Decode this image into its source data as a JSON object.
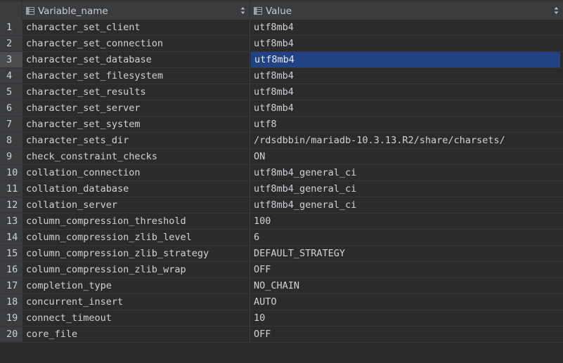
{
  "columns": {
    "variable_name": "Variable_name",
    "value": "Value"
  },
  "icons": {
    "column_icon": "table-column-icon",
    "sort_icon": "sort-arrows-icon"
  },
  "colors": {
    "background": "#2b2b2b",
    "header": "#3a3c3e",
    "selection": "#214283",
    "text": "#cfd3d8"
  },
  "selected_row": 3,
  "rows": [
    {
      "num": "1",
      "name": "character_set_client",
      "value": "utf8mb4"
    },
    {
      "num": "2",
      "name": "character_set_connection",
      "value": "utf8mb4"
    },
    {
      "num": "3",
      "name": "character_set_database",
      "value": "utf8mb4"
    },
    {
      "num": "4",
      "name": "character_set_filesystem",
      "value": "utf8mb4"
    },
    {
      "num": "5",
      "name": "character_set_results",
      "value": "utf8mb4"
    },
    {
      "num": "6",
      "name": "character_set_server",
      "value": "utf8mb4"
    },
    {
      "num": "7",
      "name": "character_set_system",
      "value": "utf8"
    },
    {
      "num": "8",
      "name": "character_sets_dir",
      "value": "/rdsdbbin/mariadb-10.3.13.R2/share/charsets/"
    },
    {
      "num": "9",
      "name": "check_constraint_checks",
      "value": "ON"
    },
    {
      "num": "10",
      "name": "collation_connection",
      "value": "utf8mb4_general_ci"
    },
    {
      "num": "11",
      "name": "collation_database",
      "value": "utf8mb4_general_ci"
    },
    {
      "num": "12",
      "name": "collation_server",
      "value": "utf8mb4_general_ci"
    },
    {
      "num": "13",
      "name": "column_compression_threshold",
      "value": "100"
    },
    {
      "num": "14",
      "name": "column_compression_zlib_level",
      "value": "6"
    },
    {
      "num": "15",
      "name": "column_compression_zlib_strategy",
      "value": "DEFAULT_STRATEGY"
    },
    {
      "num": "16",
      "name": "column_compression_zlib_wrap",
      "value": "OFF"
    },
    {
      "num": "17",
      "name": "completion_type",
      "value": "NO_CHAIN"
    },
    {
      "num": "18",
      "name": "concurrent_insert",
      "value": "AUTO"
    },
    {
      "num": "19",
      "name": "connect_timeout",
      "value": "10"
    },
    {
      "num": "20",
      "name": "core_file",
      "value": "OFF"
    }
  ]
}
